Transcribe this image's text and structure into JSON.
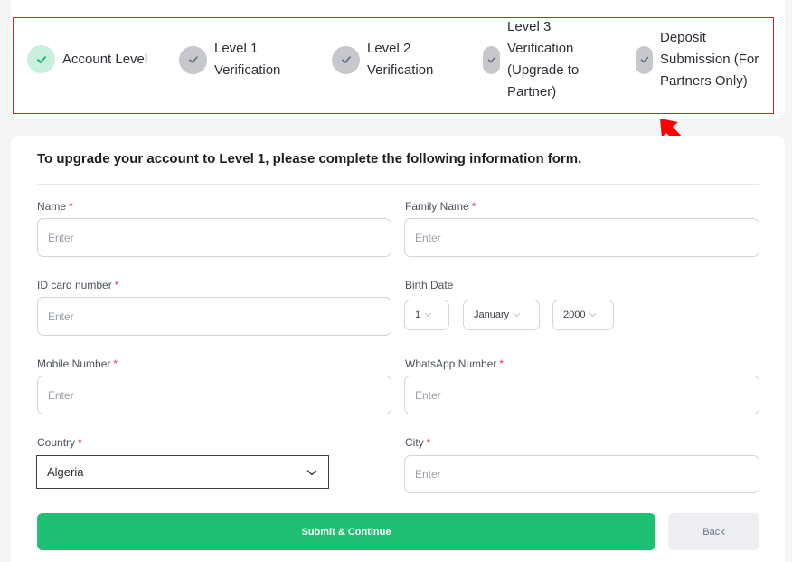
{
  "stepper": {
    "steps": [
      {
        "lines": [
          "Account Level"
        ],
        "status": "done"
      },
      {
        "lines": [
          "Level 1",
          "Verification"
        ],
        "status": "pending"
      },
      {
        "lines": [
          "Level 2",
          "Verification"
        ],
        "status": "pending"
      },
      {
        "lines": [
          "Level 3",
          "Verification",
          "(Upgrade to",
          "Partner)"
        ],
        "status": "pending"
      },
      {
        "lines": [
          "Deposit",
          "Submission (For",
          "Partners Only)"
        ],
        "status": "pending"
      }
    ]
  },
  "form": {
    "title": "To upgrade your account to Level 1, please complete the following information form.",
    "required_mark": "*",
    "fields": {
      "name": {
        "label": "Name",
        "placeholder": "Enter"
      },
      "family_name": {
        "label": "Family Name",
        "placeholder": "Enter"
      },
      "id_card": {
        "label": "ID card number",
        "placeholder": "Enter"
      },
      "birth_date": {
        "label": "Birth Date",
        "day": "1",
        "month": "January",
        "year": "2000"
      },
      "mobile": {
        "label": "Mobile Number",
        "placeholder": "Enter"
      },
      "whatsapp": {
        "label": "WhatsApp Number",
        "placeholder": "Enter"
      },
      "country": {
        "label": "Country",
        "value": "Algeria"
      },
      "city": {
        "label": "City",
        "placeholder": "Enter"
      }
    },
    "buttons": {
      "submit": "Submit & Continue",
      "back": "Back"
    }
  },
  "colors": {
    "accent_green": "#1fbf74",
    "highlight_red": "#e01e1e",
    "required_red": "#e3325a"
  }
}
